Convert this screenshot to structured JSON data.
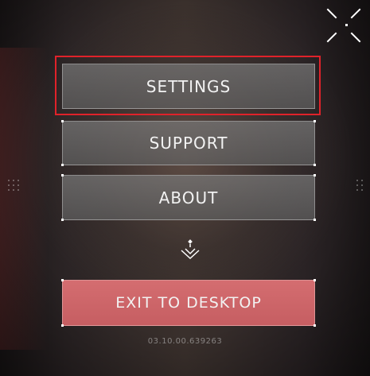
{
  "menu": {
    "settings_label": "SETTINGS",
    "support_label": "SUPPORT",
    "about_label": "ABOUT",
    "exit_label": "EXIT TO DESKTOP"
  },
  "icons": {
    "fullscreen": "fullscreen-toggle-icon",
    "expand": "expand-more-chevron-icon"
  },
  "version": "03.10.00.639263",
  "colors": {
    "button_gray": "#6e6e6e",
    "exit_red": "#c96064",
    "highlight_red": "#e0222a",
    "text": "#f2f2f2"
  }
}
